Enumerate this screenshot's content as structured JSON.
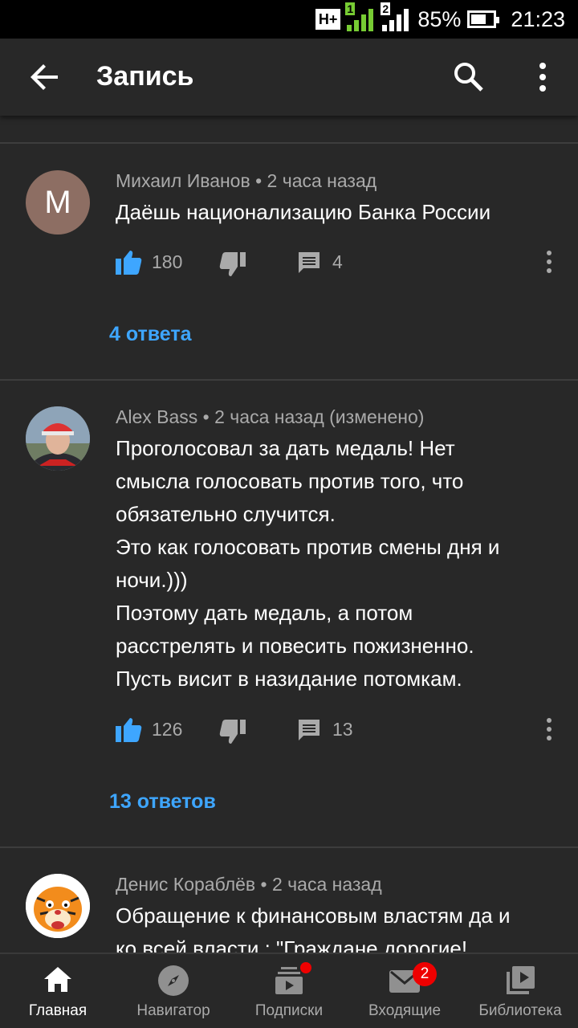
{
  "status_bar": {
    "network": "H+",
    "sim1": "1",
    "sim2": "2",
    "battery": "85%",
    "time": "21:23"
  },
  "app_bar": {
    "title": "Запись",
    "icons": [
      "back-arrow-icon",
      "search-icon",
      "more-vert-icon"
    ]
  },
  "comments": [
    {
      "avatar_letter": "M",
      "avatar_color": "#8d6e63",
      "author": "Михаил Иванов",
      "time": "2 часа назад",
      "edited": "",
      "text": "Даёшь национализацию Банка России",
      "likes": "180",
      "reply_count": "4",
      "replies_label": "4 ответа"
    },
    {
      "avatar_letter": "",
      "author": "Alex Bass",
      "time": "2 часа назад",
      "edited": "(изменено)",
      "text_lines": [
        "Проголосовал за дать медаль!  Нет",
        "смысла голосовать против того, что",
        "обязательно случится.",
        "Это как голосовать против смены дня и",
        "ночи.)))",
        "Поэтому дать медаль, а потом",
        "расстрелять и повесить  пожизненно.",
        "Пусть висит в назидание потомкам."
      ],
      "likes": "126",
      "reply_count": "13",
      "replies_label": "13 ответов"
    },
    {
      "author": "Денис Кораблёв",
      "time": "2 часа назад",
      "edited": "",
      "text_lines": [
        "Обращение к финансовым властям да и",
        "ко всей власти : \"Граждане дорогие!"
      ]
    }
  ],
  "bottom_nav": {
    "items": [
      {
        "label": "Главная",
        "icon": "home-icon",
        "active": true
      },
      {
        "label": "Навигатор",
        "icon": "compass-icon",
        "active": false
      },
      {
        "label": "Подписки",
        "icon": "subscriptions-icon",
        "active": false
      },
      {
        "label": "Входящие",
        "icon": "inbox-icon",
        "active": false,
        "badge": "2"
      },
      {
        "label": "Библиотека",
        "icon": "library-icon",
        "active": false
      }
    ]
  },
  "colors": {
    "background": "#282828",
    "accent_link": "#3ea6ff",
    "like_active": "#3ea6ff",
    "badge": "#ee0000"
  }
}
